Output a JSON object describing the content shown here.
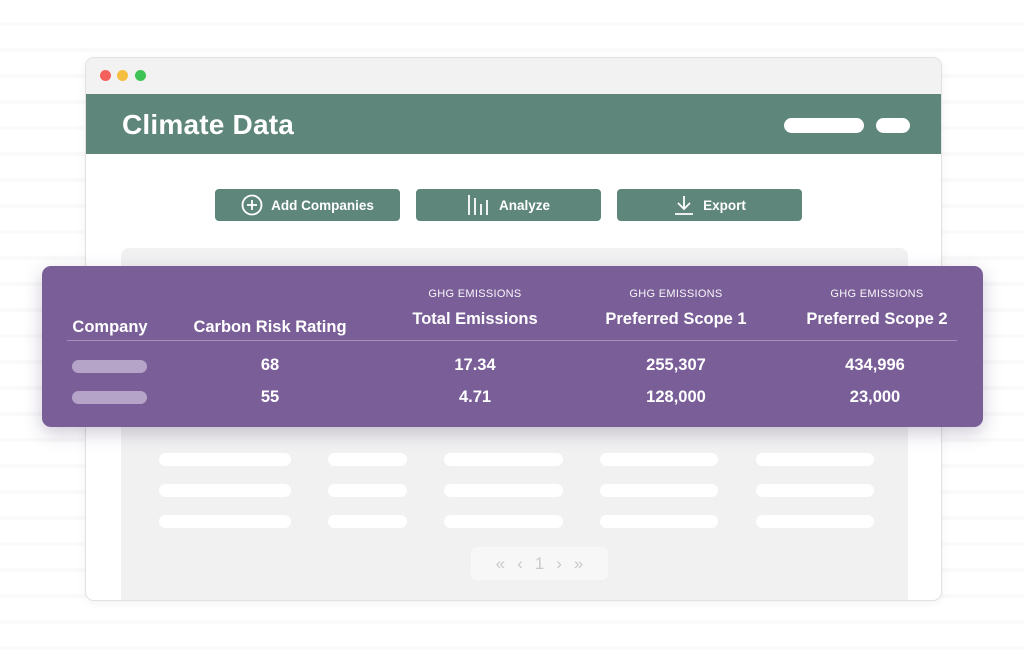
{
  "app": {
    "title": "Climate Data"
  },
  "toolbar": {
    "add_label": "Add Companies",
    "analyze_label": "Analyze",
    "export_label": "Export"
  },
  "table": {
    "columns": [
      {
        "super": "",
        "label": "Company"
      },
      {
        "super": "",
        "label": "Carbon Risk Rating"
      },
      {
        "super": "GHG EMISSIONS",
        "label": "Total Emissions"
      },
      {
        "super": "GHG EMISSIONS",
        "label": "Preferred Scope 1"
      },
      {
        "super": "GHG EMISSIONS",
        "label": "Preferred Scope 2"
      }
    ],
    "rows": [
      {
        "rating": "68",
        "total": "17.34",
        "scope1": "255,307",
        "scope2": "434,996"
      },
      {
        "rating": "55",
        "total": "4.71",
        "scope1": "128,000",
        "scope2": "23,000"
      }
    ]
  },
  "pager": {
    "page": "1"
  },
  "colors": {
    "header_green": "#5f867a",
    "card_purple": "#7a5e98"
  },
  "icons": {
    "add": "plus-circle-icon",
    "analyze": "bar-chart-icon",
    "export": "download-icon"
  }
}
